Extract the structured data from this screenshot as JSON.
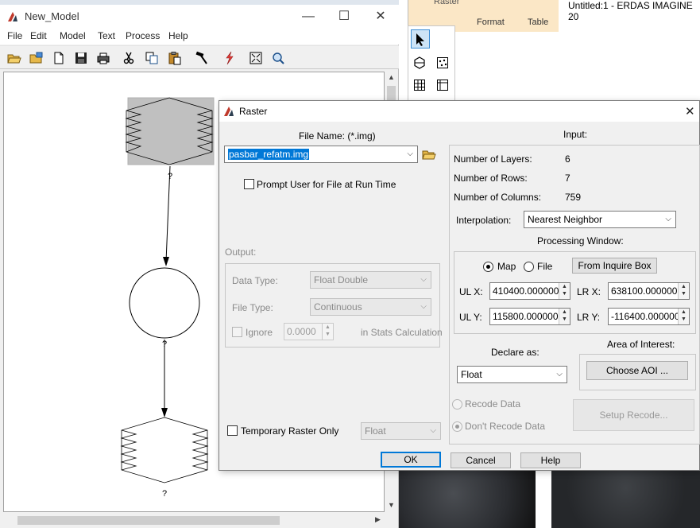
{
  "model_window": {
    "title": "New_Model",
    "controls": {
      "minimize": "—",
      "maximize": "☐",
      "close": "✕"
    },
    "menu": [
      "File",
      "Edit",
      "Model",
      "Text",
      "Process",
      "Help"
    ],
    "toolbar_icons": [
      "open-folder-icon",
      "open-model-icon",
      "new-document-icon",
      "save-icon",
      "print-icon",
      "cut-icon",
      "copy-icon",
      "paste-icon",
      "hammer-icon",
      "run-icon",
      "zoom-fit-icon",
      "zoom-icon"
    ],
    "node_labels": [
      "?",
      "?",
      "?"
    ]
  },
  "backdrop": {
    "app_title": "Untitled:1 - ERDAS IMAGINE 20",
    "ribbon_tab_partial": "Raster",
    "ribbon_tabs": [
      "Format",
      "Table"
    ]
  },
  "dialog": {
    "title": "Raster",
    "close": "✕",
    "file_name_label": "File Name: (*.img)",
    "file_name_value": "pasbar_refatm.img",
    "prompt_label": "Prompt User for File at Run Time",
    "output_label": "Output:",
    "data_type_label": "Data Type:",
    "data_type_value": "Float Double",
    "file_type_label": "File Type:",
    "file_type_value": "Continuous",
    "ignore_label": "Ignore",
    "ignore_value": "0.0000",
    "stats_label": "in Stats Calculation",
    "temp_raster_label": "Temporary Raster Only",
    "temp_raster_type": "Float",
    "input_label": "Input:",
    "layers_label": "Number of Layers:",
    "layers_value": "6",
    "rows_label": "Number of Rows:",
    "rows_value": "7",
    "cols_label": "Number of Columns:",
    "cols_value": "759",
    "interp_label": "Interpolation:",
    "interp_value": "Nearest Neighbor",
    "proc_window_label": "Processing Window:",
    "map_label": "Map",
    "file_label": "File",
    "inquire_button": "From Inquire Box",
    "ulx_label": "UL X:",
    "ulx_value": "410400.000000",
    "lrx_label": "LR X:",
    "lrx_value": "638100.000000",
    "uly_label": "UL Y:",
    "uly_value": "115800.000000",
    "lry_label": "LR Y:",
    "lry_value": "-116400.000000",
    "declare_label": "Declare as:",
    "declare_value": "Float",
    "aoi_label": "Area of Interest:",
    "choose_aoi_button": "Choose AOI ...",
    "recode_label": "Recode Data",
    "no_recode_label": "Don't Recode Data",
    "setup_recode_button": "Setup Recode...",
    "ok_button": "OK",
    "cancel_button": "Cancel",
    "help_button": "Help"
  }
}
